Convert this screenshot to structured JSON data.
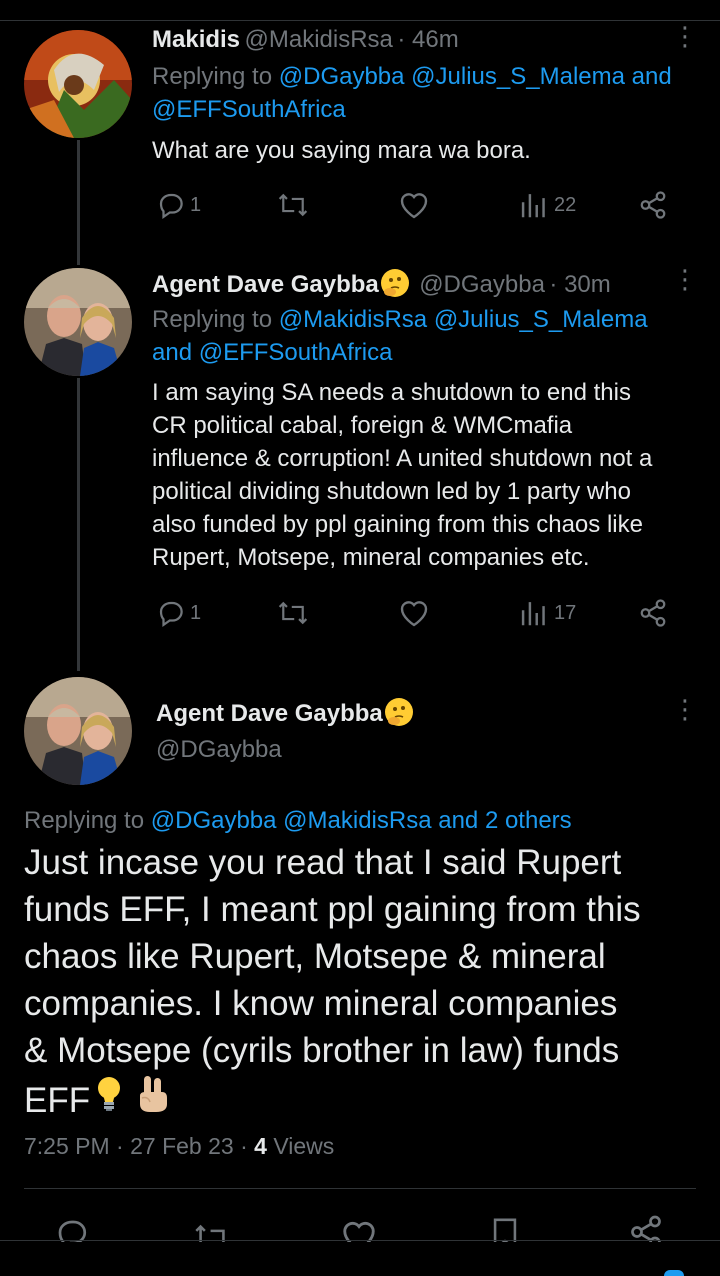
{
  "tweets": [
    {
      "name": "Makidis",
      "handle": "@MakidisRsa",
      "time": "· 46m",
      "replying_prefix": "Replying to",
      "replying_line1": "@DGaybba @Julius_S_Malema and",
      "replying_line2": "@EFFSouthAfrica",
      "text": "What are you saying mara wa bora.",
      "replies": "1",
      "views": "22"
    },
    {
      "name": "Agent Dave Gaybba",
      "handle": "@DGaybba",
      "time": "· 30m",
      "replying_prefix": "Replying to",
      "replying_line1": "@MakidisRsa @Julius_S_Malema",
      "replying_line2": "and @EFFSouthAfrica",
      "text_lines": [
        "I am saying SA needs a shutdown to end this",
        "CR political cabal, foreign & WMCmafia",
        "influence & corruption! A united shutdown not a",
        "political dividing shutdown led by 1 party who",
        "also funded by ppl gaining from this chaos like",
        "Rupert, Motsepe, mineral companies etc."
      ],
      "replies": "1",
      "views": "17"
    }
  ],
  "main": {
    "name": "Agent Dave Gaybba",
    "handle": "@DGaybba",
    "replying_prefix": "Replying to",
    "replying_targets": "@DGaybba @MakidisRsa and 2 others",
    "text_lines": [
      "Just incase you read that I said Rupert",
      "funds EFF, I meant ppl gaining from this",
      "chaos like Rupert, Motsepe & mineral",
      "companies. I know mineral companies",
      "& Motsepe (cyrils brother in law) funds",
      "EFF"
    ],
    "time": "7:25 PM",
    "date": "27 Feb 23",
    "views_count": "4",
    "views_label": "Views"
  },
  "colors": {
    "background": "#000000",
    "text": "#e7e9ea",
    "muted": "#71767b",
    "link": "#1d9bf0"
  },
  "icons": [
    "reply-icon",
    "retweet-icon",
    "like-icon",
    "views-icon",
    "share-icon",
    "more-icon",
    "thinking-emoji",
    "lightbulb-emoji",
    "victory-hand-emoji",
    "bookmark-icon"
  ]
}
